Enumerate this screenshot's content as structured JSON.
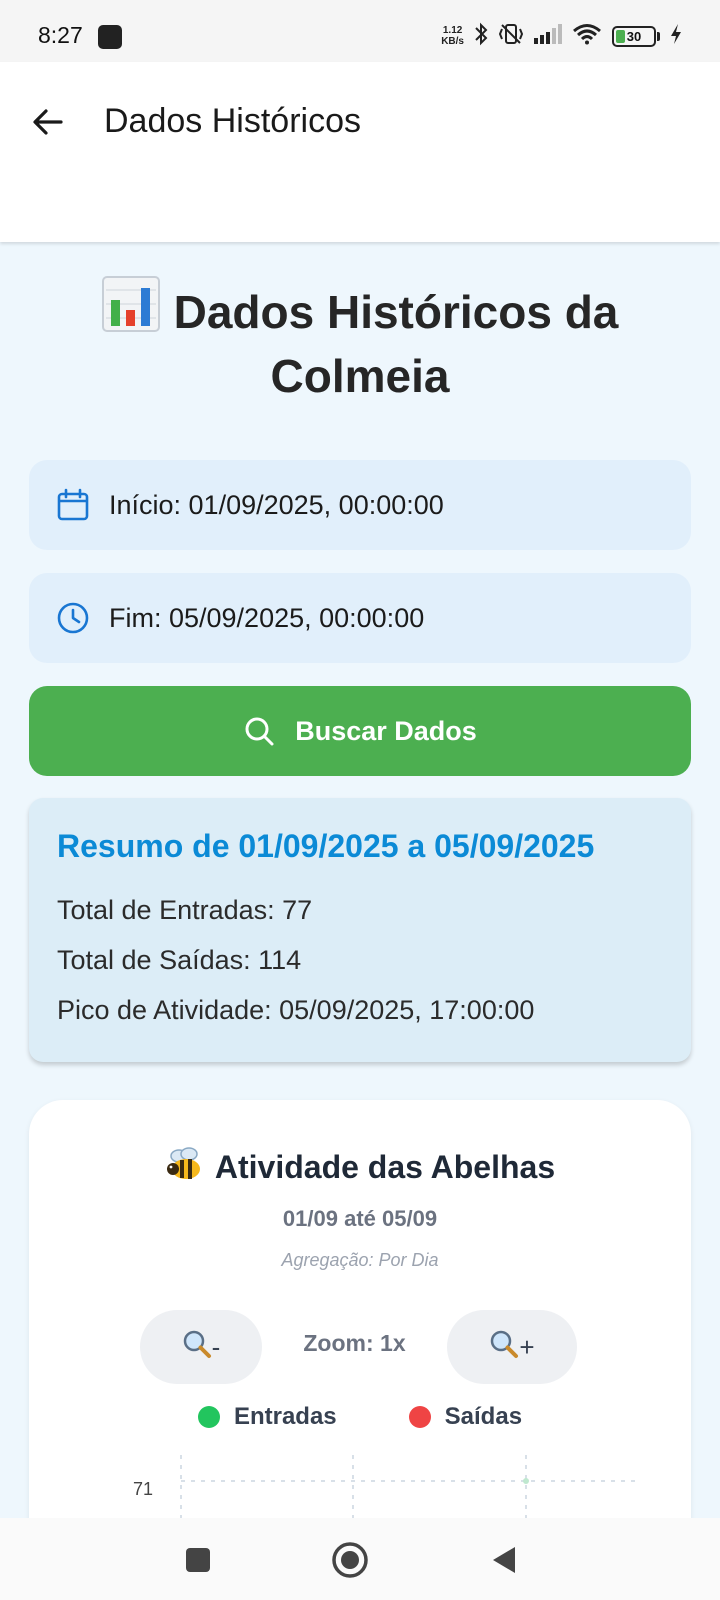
{
  "status_bar": {
    "time": "8:27",
    "net_speed_value": "1.12",
    "net_speed_unit": "KB/s",
    "battery_level": "30"
  },
  "app_bar": {
    "title": "Dados Históricos"
  },
  "page": {
    "title": "Dados Históricos da Colmeia"
  },
  "filters": {
    "start_label": "Início: 01/09/2025, 00:00:00",
    "end_label": "Fim: 05/09/2025, 00:00:00",
    "search_button_label": "Buscar Dados"
  },
  "summary": {
    "title": "Resumo de 01/09/2025 a 05/09/2025",
    "total_entries": "Total de Entradas: 77",
    "total_exits": "Total de Saídas: 114",
    "peak_activity": "Pico de Atividade: 05/09/2025, 17:00:00"
  },
  "chart_card": {
    "title": "Atividade das Abelhas",
    "range": "01/09 até 05/09",
    "aggregation": "Agregação: Por Dia",
    "zoom_out_label": "-",
    "zoom_in_label": "+",
    "zoom_label": "Zoom: 1x",
    "legend": [
      {
        "label": "Entradas",
        "color": "#22c55e"
      },
      {
        "label": "Saídas",
        "color": "#ef4444"
      }
    ],
    "y_tick_top": "71"
  },
  "colors": {
    "accent_blue": "#0b8ad6",
    "search_green": "#4caf50",
    "field_bg": "#e1effb",
    "summary_bg": "#dcedf7"
  }
}
